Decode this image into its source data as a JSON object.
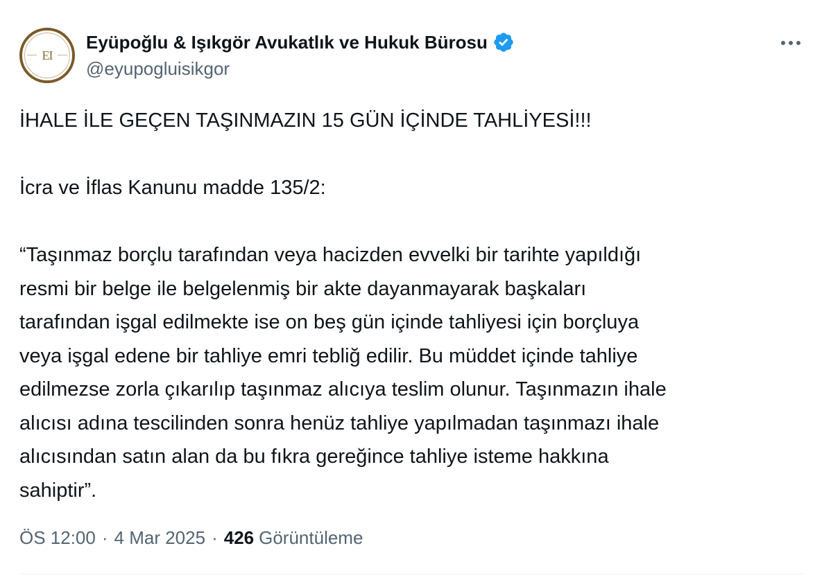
{
  "author": {
    "display_name": "Eyüpoğlu & Işıkgör Avukatlık ve Hukuk Bürosu",
    "handle": "@eyupogluisikgor",
    "verified": true,
    "avatar_monogram": "EI",
    "verified_icon": "verified-badge-icon",
    "verified_color": "#1d9bf0"
  },
  "menu": {
    "icon": "more-horizontal-icon"
  },
  "tweet": {
    "paragraphs": [
      "İHALE İLE GEÇEN TAŞINMAZIN 15 GÜN İÇİNDE TAHLİYESİ!!!",
      "İcra ve İflas Kanunu madde 135/2:",
      "“Taşınmaz borçlu tarafından veya hacizden evvelki bir tarihte yapıldığı\nresmi bir belge ile belgelenmiş bir akte dayanmayarak başkaları\ntarafından işgal edilmekte ise on beş gün içinde tahliyesi için borçluya\nveya işgal edene bir tahliye emri tebliğ edilir. Bu müddet içinde tahliye\nedilmezse zorla çıkarılıp taşınmaz alıcıya teslim olunur. Taşınmazın ihale\nalıcısı adına tescilinden sonra henüz tahliye yapılmadan taşınmazı ihale\nalıcısından satın alan da bu fıkra gereğince tahliye isteme hakkına\nsahiptir”."
    ]
  },
  "meta": {
    "time": "ÖS 12:00",
    "separator": "·",
    "date": "4 Mar 2025",
    "views_count": "426",
    "views_label": "Görüntüleme"
  },
  "colors": {
    "text_primary": "#0f1419",
    "text_secondary": "#536471",
    "avatar_ring": "#7a5a2a",
    "divider": "#eff3f4"
  }
}
